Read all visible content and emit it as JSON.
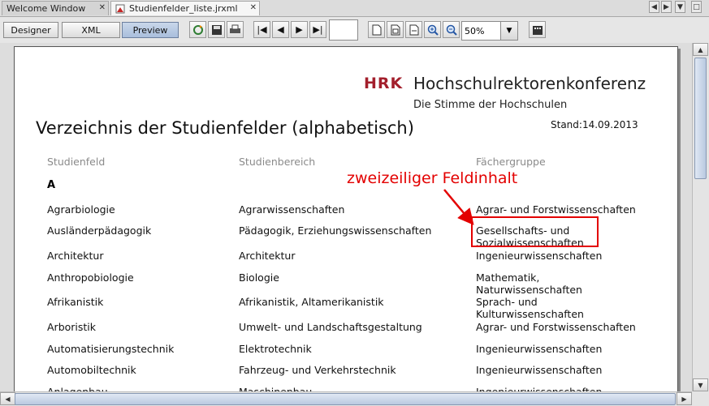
{
  "tabs": [
    {
      "label": "Welcome Window",
      "active": false
    },
    {
      "label": "Studienfelder_liste.jrxml",
      "active": true
    }
  ],
  "toolbar": {
    "modes": [
      "Designer",
      "XML",
      "Preview"
    ],
    "active_mode": "Preview",
    "page_number": "",
    "zoom": "50%"
  },
  "report": {
    "logo_abbr": "HRK",
    "logo_name": "Hochschulrektorenkonferenz",
    "logo_subtitle": "Die Stimme der Hochschulen",
    "title": "Verzeichnis der Studienfelder (alphabetisch)",
    "stand": "Stand:14.09.2013",
    "columns": [
      "Studienfeld",
      "Studienbereich",
      "Fächergruppe"
    ],
    "group_letter": "A",
    "rows": [
      {
        "feld": "Agrarbiologie",
        "bereich": "Agrarwissenschaften",
        "gruppe": "Agrar- und Forstwissenschaften"
      },
      {
        "feld": "Ausländerpädagogik",
        "bereich": "Pädagogik, Erziehungswissenschaften",
        "gruppe": "Gesellschafts- und\nSozialwissenschaften"
      },
      {
        "feld": "Architektur",
        "bereich": "Architektur",
        "gruppe": "Ingenieurwissenschaften"
      },
      {
        "feld": "Anthropobiologie",
        "bereich": "Biologie",
        "gruppe": "Mathematik,\nNaturwissenschaften"
      },
      {
        "feld": "Afrikanistik",
        "bereich": "Afrikanistik, Altamerikanistik",
        "gruppe": "Sprach- und\nKulturwissenschaften"
      },
      {
        "feld": "Arboristik",
        "bereich": "Umwelt- und Landschaftsgestaltung",
        "gruppe": "Agrar- und Forstwissenschaften"
      },
      {
        "feld": "Automatisierungstechnik",
        "bereich": "Elektrotechnik",
        "gruppe": "Ingenieurwissenschaften"
      },
      {
        "feld": "Automobiltechnik",
        "bereich": "Fahrzeug- und Verkehrstechnik",
        "gruppe": "Ingenieurwissenschaften"
      },
      {
        "feld": "Anlagenbau",
        "bereich": "Maschinenbau",
        "gruppe": "Ingenieurwissenschaften"
      }
    ]
  },
  "annotation": {
    "text": "zweizeiliger Feldinhalt",
    "color": "#e30000"
  },
  "colors": {
    "accent_red": "#a31f2c",
    "preview_active": "#b3c6e0"
  }
}
